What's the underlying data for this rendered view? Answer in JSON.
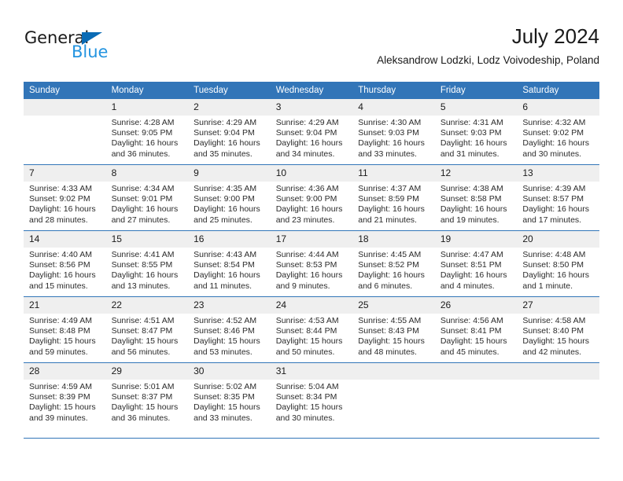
{
  "brand": {
    "name_part1": "General",
    "name_part2": "Blue",
    "triangle_color": "#0a6bb5",
    "blue_text_color": "#2494e0"
  },
  "header": {
    "title": "July 2024",
    "subtitle": "Aleksandrow Lodzki, Lodz Voivodeship, Poland"
  },
  "theme": {
    "header_blue": "#3275b8",
    "daynum_band": "#efefef",
    "text": "#1a1a1a"
  },
  "calendar": {
    "weekday_headers": [
      "Sunday",
      "Monday",
      "Tuesday",
      "Wednesday",
      "Thursday",
      "Friday",
      "Saturday"
    ],
    "weeks": [
      [
        {
          "day": "",
          "blank": true,
          "sunrise": "",
          "sunset": "",
          "daylight_line1": "",
          "daylight_line2": ""
        },
        {
          "day": "1",
          "sunrise": "Sunrise: 4:28 AM",
          "sunset": "Sunset: 9:05 PM",
          "daylight_line1": "Daylight: 16 hours",
          "daylight_line2": "and 36 minutes."
        },
        {
          "day": "2",
          "sunrise": "Sunrise: 4:29 AM",
          "sunset": "Sunset: 9:04 PM",
          "daylight_line1": "Daylight: 16 hours",
          "daylight_line2": "and 35 minutes."
        },
        {
          "day": "3",
          "sunrise": "Sunrise: 4:29 AM",
          "sunset": "Sunset: 9:04 PM",
          "daylight_line1": "Daylight: 16 hours",
          "daylight_line2": "and 34 minutes."
        },
        {
          "day": "4",
          "sunrise": "Sunrise: 4:30 AM",
          "sunset": "Sunset: 9:03 PM",
          "daylight_line1": "Daylight: 16 hours",
          "daylight_line2": "and 33 minutes."
        },
        {
          "day": "5",
          "sunrise": "Sunrise: 4:31 AM",
          "sunset": "Sunset: 9:03 PM",
          "daylight_line1": "Daylight: 16 hours",
          "daylight_line2": "and 31 minutes."
        },
        {
          "day": "6",
          "sunrise": "Sunrise: 4:32 AM",
          "sunset": "Sunset: 9:02 PM",
          "daylight_line1": "Daylight: 16 hours",
          "daylight_line2": "and 30 minutes."
        }
      ],
      [
        {
          "day": "7",
          "sunrise": "Sunrise: 4:33 AM",
          "sunset": "Sunset: 9:02 PM",
          "daylight_line1": "Daylight: 16 hours",
          "daylight_line2": "and 28 minutes."
        },
        {
          "day": "8",
          "sunrise": "Sunrise: 4:34 AM",
          "sunset": "Sunset: 9:01 PM",
          "daylight_line1": "Daylight: 16 hours",
          "daylight_line2": "and 27 minutes."
        },
        {
          "day": "9",
          "sunrise": "Sunrise: 4:35 AM",
          "sunset": "Sunset: 9:00 PM",
          "daylight_line1": "Daylight: 16 hours",
          "daylight_line2": "and 25 minutes."
        },
        {
          "day": "10",
          "sunrise": "Sunrise: 4:36 AM",
          "sunset": "Sunset: 9:00 PM",
          "daylight_line1": "Daylight: 16 hours",
          "daylight_line2": "and 23 minutes."
        },
        {
          "day": "11",
          "sunrise": "Sunrise: 4:37 AM",
          "sunset": "Sunset: 8:59 PM",
          "daylight_line1": "Daylight: 16 hours",
          "daylight_line2": "and 21 minutes."
        },
        {
          "day": "12",
          "sunrise": "Sunrise: 4:38 AM",
          "sunset": "Sunset: 8:58 PM",
          "daylight_line1": "Daylight: 16 hours",
          "daylight_line2": "and 19 minutes."
        },
        {
          "day": "13",
          "sunrise": "Sunrise: 4:39 AM",
          "sunset": "Sunset: 8:57 PM",
          "daylight_line1": "Daylight: 16 hours",
          "daylight_line2": "and 17 minutes."
        }
      ],
      [
        {
          "day": "14",
          "sunrise": "Sunrise: 4:40 AM",
          "sunset": "Sunset: 8:56 PM",
          "daylight_line1": "Daylight: 16 hours",
          "daylight_line2": "and 15 minutes."
        },
        {
          "day": "15",
          "sunrise": "Sunrise: 4:41 AM",
          "sunset": "Sunset: 8:55 PM",
          "daylight_line1": "Daylight: 16 hours",
          "daylight_line2": "and 13 minutes."
        },
        {
          "day": "16",
          "sunrise": "Sunrise: 4:43 AM",
          "sunset": "Sunset: 8:54 PM",
          "daylight_line1": "Daylight: 16 hours",
          "daylight_line2": "and 11 minutes."
        },
        {
          "day": "17",
          "sunrise": "Sunrise: 4:44 AM",
          "sunset": "Sunset: 8:53 PM",
          "daylight_line1": "Daylight: 16 hours",
          "daylight_line2": "and 9 minutes."
        },
        {
          "day": "18",
          "sunrise": "Sunrise: 4:45 AM",
          "sunset": "Sunset: 8:52 PM",
          "daylight_line1": "Daylight: 16 hours",
          "daylight_line2": "and 6 minutes."
        },
        {
          "day": "19",
          "sunrise": "Sunrise: 4:47 AM",
          "sunset": "Sunset: 8:51 PM",
          "daylight_line1": "Daylight: 16 hours",
          "daylight_line2": "and 4 minutes."
        },
        {
          "day": "20",
          "sunrise": "Sunrise: 4:48 AM",
          "sunset": "Sunset: 8:50 PM",
          "daylight_line1": "Daylight: 16 hours",
          "daylight_line2": "and 1 minute."
        }
      ],
      [
        {
          "day": "21",
          "sunrise": "Sunrise: 4:49 AM",
          "sunset": "Sunset: 8:48 PM",
          "daylight_line1": "Daylight: 15 hours",
          "daylight_line2": "and 59 minutes."
        },
        {
          "day": "22",
          "sunrise": "Sunrise: 4:51 AM",
          "sunset": "Sunset: 8:47 PM",
          "daylight_line1": "Daylight: 15 hours",
          "daylight_line2": "and 56 minutes."
        },
        {
          "day": "23",
          "sunrise": "Sunrise: 4:52 AM",
          "sunset": "Sunset: 8:46 PM",
          "daylight_line1": "Daylight: 15 hours",
          "daylight_line2": "and 53 minutes."
        },
        {
          "day": "24",
          "sunrise": "Sunrise: 4:53 AM",
          "sunset": "Sunset: 8:44 PM",
          "daylight_line1": "Daylight: 15 hours",
          "daylight_line2": "and 50 minutes."
        },
        {
          "day": "25",
          "sunrise": "Sunrise: 4:55 AM",
          "sunset": "Sunset: 8:43 PM",
          "daylight_line1": "Daylight: 15 hours",
          "daylight_line2": "and 48 minutes."
        },
        {
          "day": "26",
          "sunrise": "Sunrise: 4:56 AM",
          "sunset": "Sunset: 8:41 PM",
          "daylight_line1": "Daylight: 15 hours",
          "daylight_line2": "and 45 minutes."
        },
        {
          "day": "27",
          "sunrise": "Sunrise: 4:58 AM",
          "sunset": "Sunset: 8:40 PM",
          "daylight_line1": "Daylight: 15 hours",
          "daylight_line2": "and 42 minutes."
        }
      ],
      [
        {
          "day": "28",
          "sunrise": "Sunrise: 4:59 AM",
          "sunset": "Sunset: 8:39 PM",
          "daylight_line1": "Daylight: 15 hours",
          "daylight_line2": "and 39 minutes."
        },
        {
          "day": "29",
          "sunrise": "Sunrise: 5:01 AM",
          "sunset": "Sunset: 8:37 PM",
          "daylight_line1": "Daylight: 15 hours",
          "daylight_line2": "and 36 minutes."
        },
        {
          "day": "30",
          "sunrise": "Sunrise: 5:02 AM",
          "sunset": "Sunset: 8:35 PM",
          "daylight_line1": "Daylight: 15 hours",
          "daylight_line2": "and 33 minutes."
        },
        {
          "day": "31",
          "sunrise": "Sunrise: 5:04 AM",
          "sunset": "Sunset: 8:34 PM",
          "daylight_line1": "Daylight: 15 hours",
          "daylight_line2": "and 30 minutes."
        },
        {
          "day": "",
          "blank": true,
          "sunrise": "",
          "sunset": "",
          "daylight_line1": "",
          "daylight_line2": ""
        },
        {
          "day": "",
          "blank": true,
          "sunrise": "",
          "sunset": "",
          "daylight_line1": "",
          "daylight_line2": ""
        },
        {
          "day": "",
          "blank": true,
          "sunrise": "",
          "sunset": "",
          "daylight_line1": "",
          "daylight_line2": ""
        }
      ]
    ]
  }
}
